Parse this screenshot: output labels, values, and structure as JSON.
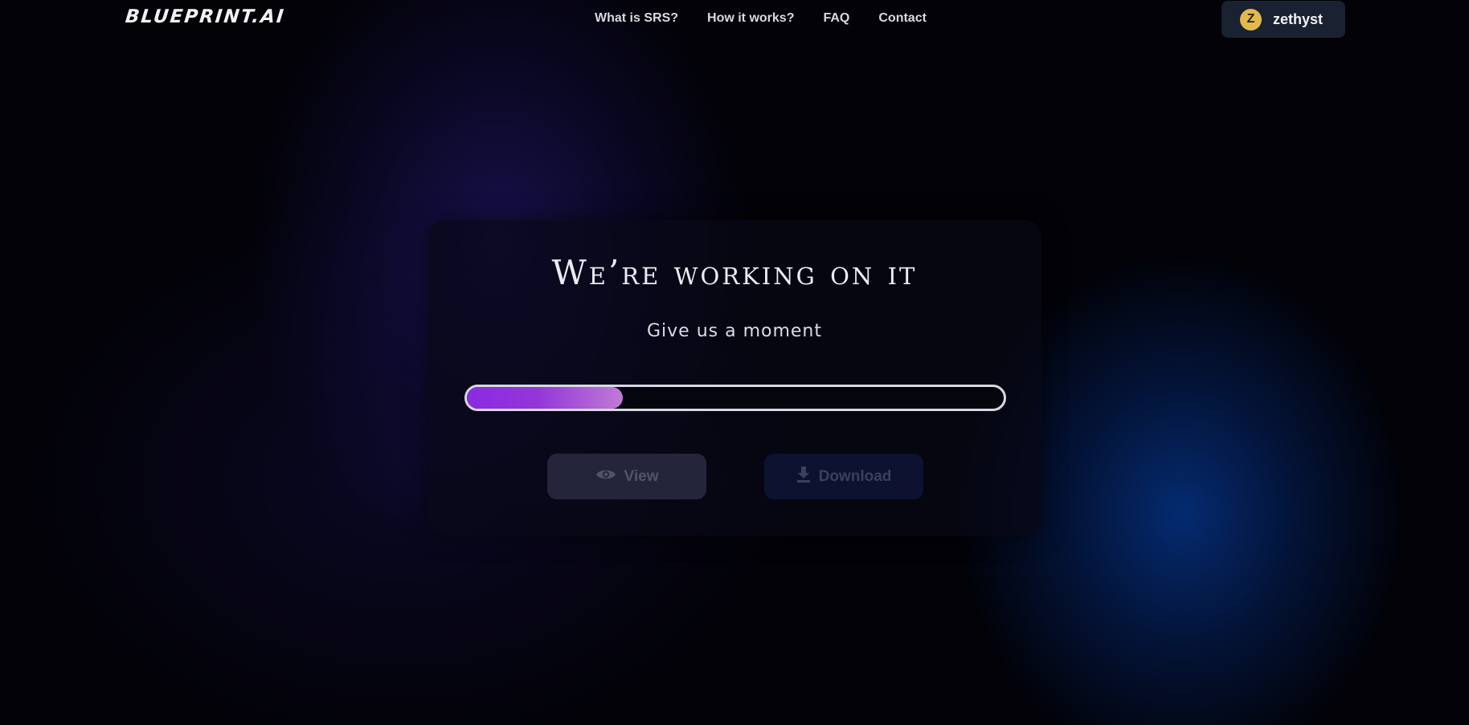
{
  "brand": {
    "logo_text": "BLUEPRINT.AI"
  },
  "nav": {
    "links": [
      {
        "label": "What is SRS?"
      },
      {
        "label": "How it works?"
      },
      {
        "label": "FAQ"
      },
      {
        "label": "Contact"
      }
    ]
  },
  "user": {
    "initial": "Z",
    "name": "zethyst",
    "avatar_color": "#e2b94c"
  },
  "status": {
    "title": "We’re working on it",
    "subtitle": "Give us a moment",
    "progress_fraction": 0.29,
    "progress_colors": [
      "#8a2be2",
      "#c07ad6"
    ]
  },
  "actions": {
    "view_label": "View",
    "view_icon": "eye-icon",
    "download_label": "Download",
    "download_icon": "download-icon"
  }
}
